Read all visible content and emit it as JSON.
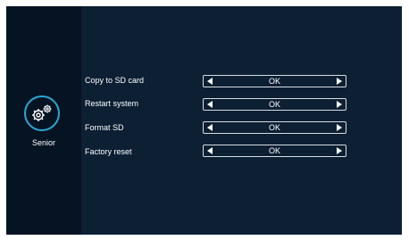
{
  "sidebar": {
    "item": {
      "label": "Senior",
      "icon": "gears-icon",
      "accent": "#2aa7d6"
    }
  },
  "settings": [
    {
      "label": "Copy to SD card",
      "value": "OK"
    },
    {
      "label": "Restart system",
      "value": "OK"
    },
    {
      "label": "Format SD",
      "value": "OK"
    },
    {
      "label": "Factory reset",
      "value": "OK"
    }
  ],
  "colors": {
    "background": "#0c1f33",
    "sidebar": "#061322",
    "text": "#ffffff"
  }
}
